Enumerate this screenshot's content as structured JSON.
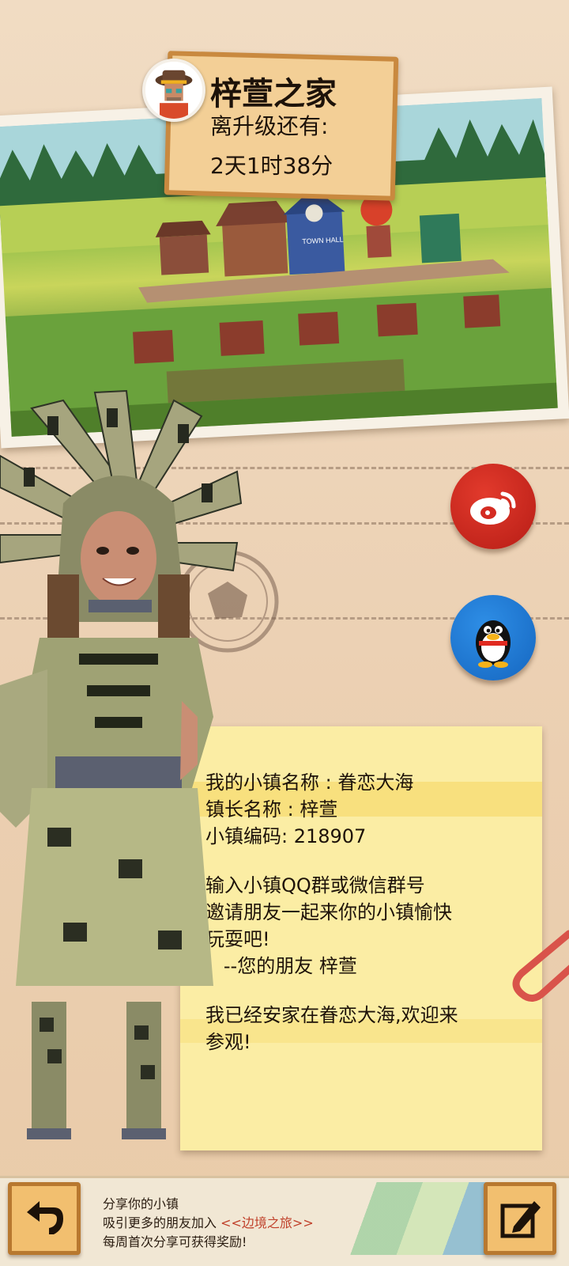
{
  "header": {
    "home_title": "梓萱之家",
    "upgrade_label": "离升级还有:",
    "upgrade_time": "2天1时38分"
  },
  "photo": {
    "town_hall_sign": "TOWN HALL"
  },
  "social": {
    "weibo_icon": "weibo-icon",
    "qq_icon": "qq-penguin-icon"
  },
  "note": {
    "town_name_line": "我的小镇名称 : 眷恋大海",
    "mayor_line": "镇长名称 : 梓萱",
    "code_line": "小镇编码: 218907",
    "invite_line1": "输入小镇QQ群或微信群号",
    "invite_line2": "邀请朋友一起来你的小镇愉快",
    "invite_line3": "玩耍吧!",
    "signature": "   --您的朋友 梓萱",
    "settled_line1": "我已经安家在眷恋大海,欢迎来",
    "settled_line2": "参观!"
  },
  "bottom": {
    "share_line1": "分享你的小镇",
    "share_line2_prefix": "吸引更多的朋友加入 ",
    "share_line2_accent": "<<边境之旅>>",
    "share_line3": "每周首次分享可获得奖励!",
    "back_icon": "back-arrow-icon",
    "edit_icon": "edit-pencil-icon"
  },
  "colors": {
    "weibo_red": "#d42b22",
    "qq_blue": "#1f7ad6",
    "note_yellow": "#fbeda4",
    "plate_wood": "#f3cf96"
  }
}
